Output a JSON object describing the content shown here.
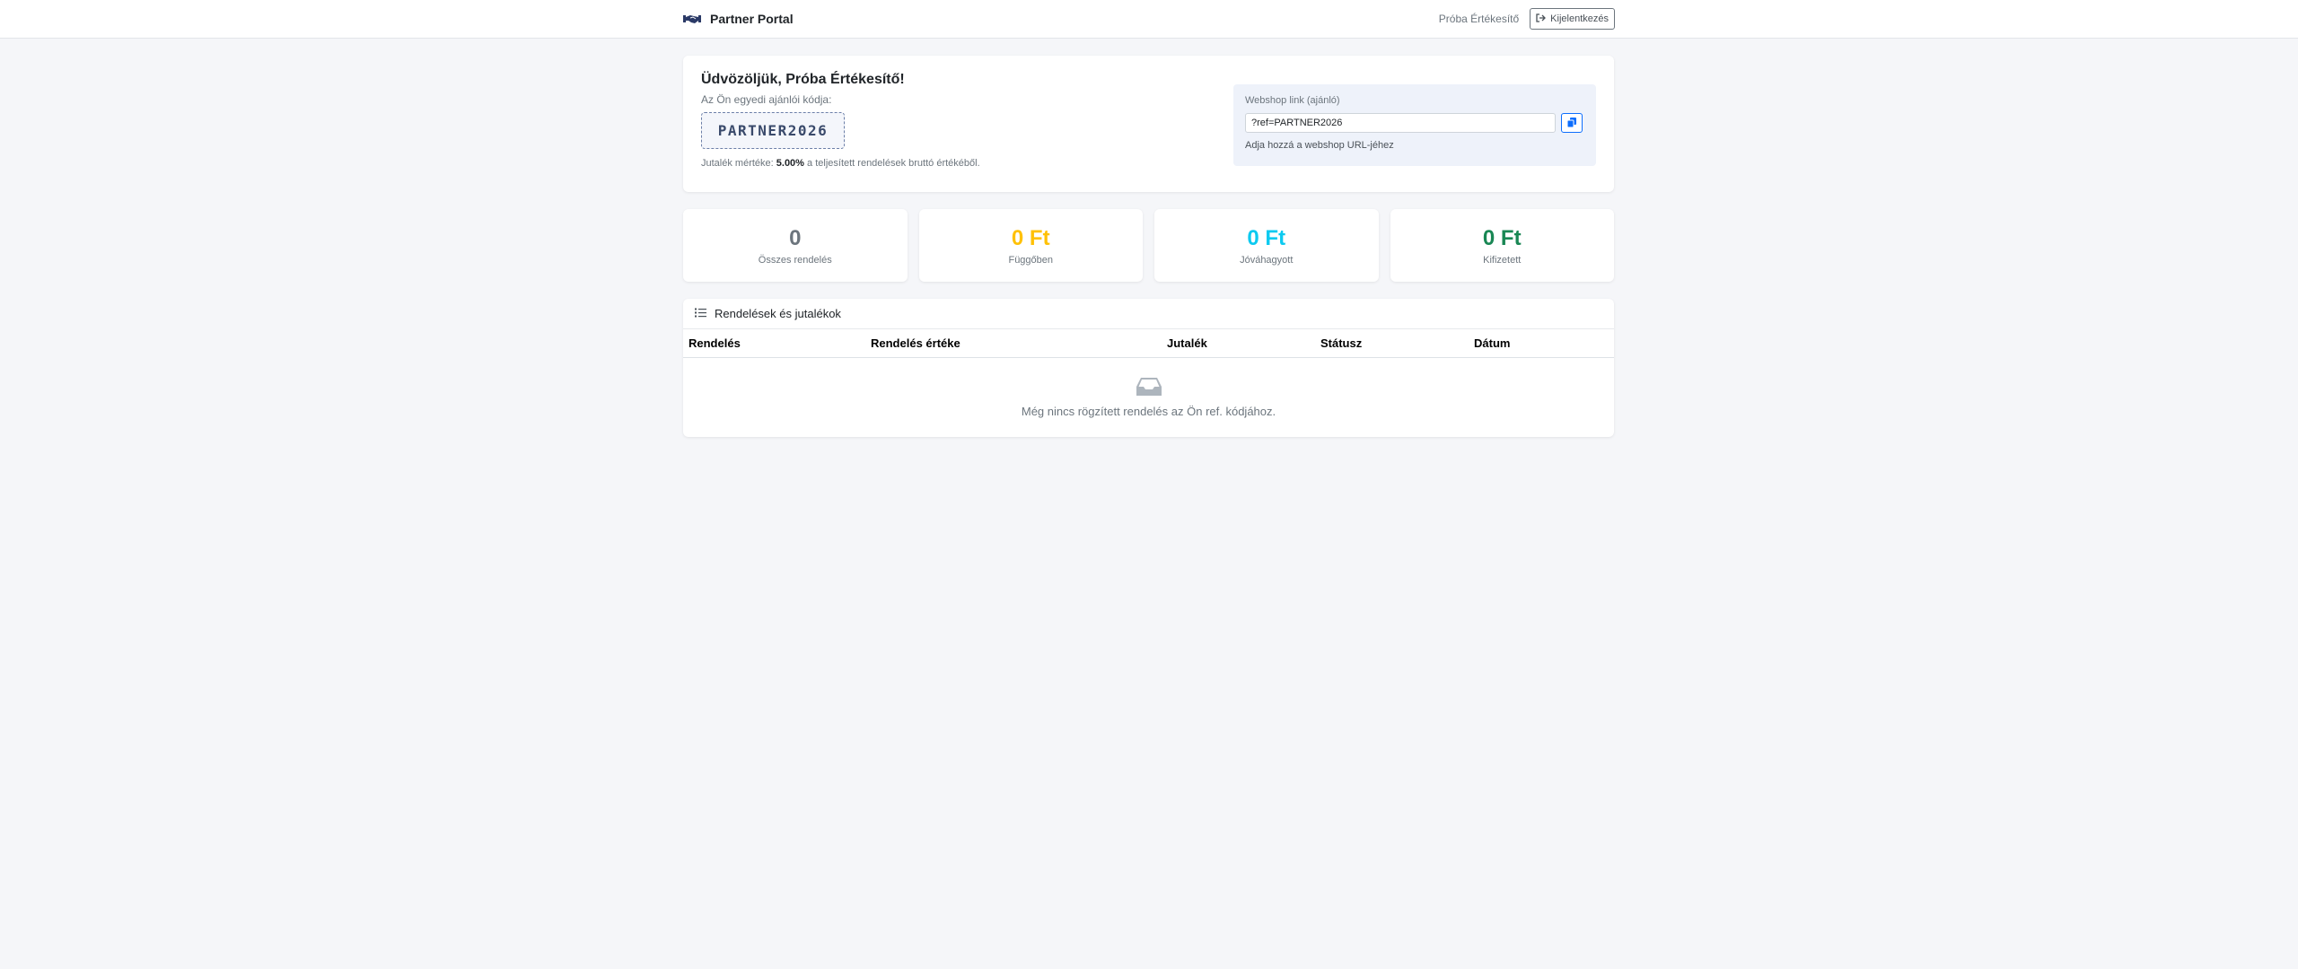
{
  "navbar": {
    "brand_title": "Partner Portal",
    "user_name": "Próba Értékesítő",
    "logout_label": "Kijelentkezés"
  },
  "welcome": {
    "title": "Üdvözöljük, Próba Értékesítő!",
    "code_label": "Az Ön egyedi ajánlói kódja:",
    "code": "PARTNER2026",
    "reward_prefix": "Jutalék mértéke:",
    "reward_rate": "5.00%",
    "reward_suffix": "a teljesített rendelések bruttó értékéből."
  },
  "webshop_link": {
    "label": "Webshop link (ajánló)",
    "value": "?ref=PARTNER2026",
    "hint": "Adja hozzá a webshop URL-jéhez"
  },
  "stats": [
    {
      "value": "0",
      "label": "Összes rendelés",
      "color": "#6c757d"
    },
    {
      "value": "0 Ft",
      "label": "Függőben",
      "color": "#ffc107"
    },
    {
      "value": "0 Ft",
      "label": "Jóváhagyott",
      "color": "#0dcaf0"
    },
    {
      "value": "0 Ft",
      "label": "Kifizetett",
      "color": "#198754"
    }
  ],
  "orders": {
    "title": "Rendelések és jutalékok",
    "columns": [
      "Rendelés",
      "Rendelés értéke",
      "Jutalék",
      "Státusz",
      "Dátum"
    ],
    "empty_text": "Még nincs rögzített rendelés az Ön ref. kódjához."
  },
  "icons": {
    "brand": "handshake-icon",
    "logout": "sign-out-icon",
    "copy": "copy-icon",
    "list": "list-icon",
    "empty": "inbox-icon"
  },
  "colors": {
    "accent": "#0d6efd",
    "brand_icon": "#2b3a67"
  }
}
